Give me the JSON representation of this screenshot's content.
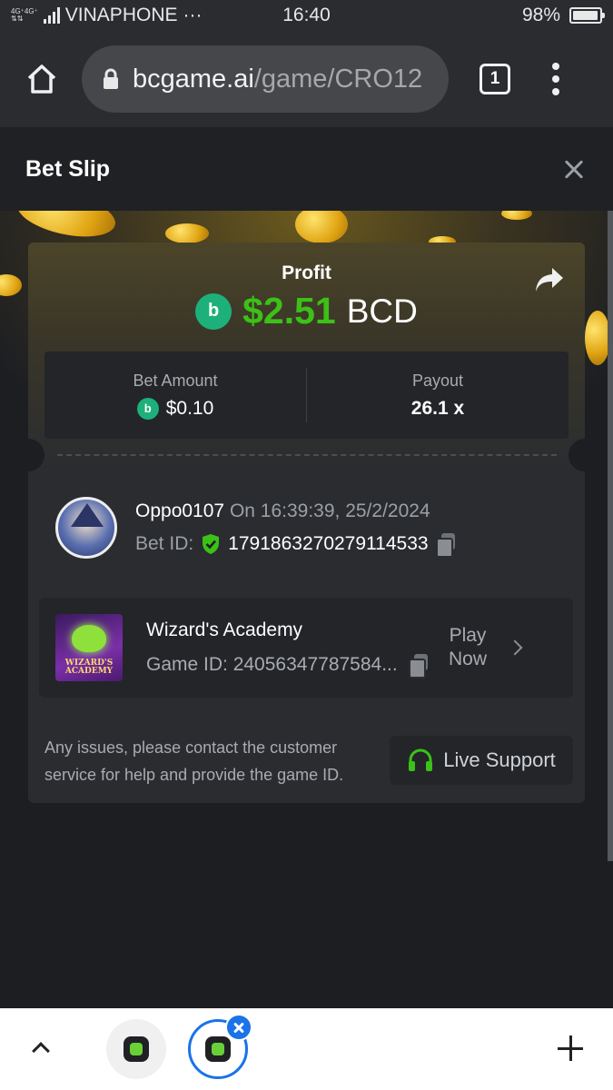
{
  "status_bar": {
    "net_top": "4G⁺4G⁺",
    "net_bottom": "⇅⇅",
    "carrier": "VINAPHONE",
    "more": "···",
    "time": "16:40",
    "battery_percent": "98%",
    "battery_level": 0.98
  },
  "browser": {
    "url_domain": "bcgame.ai",
    "url_path": "/game/CRO12",
    "tab_count": "1",
    "icons": [
      "home-icon",
      "lock-icon",
      "tabs-icon",
      "more-vert-icon"
    ]
  },
  "slip": {
    "title": "Bet Slip",
    "profit_label": "Profit",
    "profit_coin": "b",
    "profit_amount": "$2.51",
    "profit_currency": "BCD",
    "bet_amount_label": "Bet Amount",
    "bet_amount_value": "$0.10",
    "payout_label": "Payout",
    "payout_value": "26.1 x",
    "accent_green": "#3bc117",
    "coin_color": "#1db07a"
  },
  "user": {
    "name": "Oppo0107",
    "timestamp": "On 16:39:39, 25/2/2024",
    "bet_id_label": "Bet ID:",
    "bet_id": "1791863270279114533"
  },
  "game": {
    "name": "Wizard's Academy",
    "thumb_title": "WIZARD'S",
    "thumb_subtitle": "ACADEMY",
    "game_id_label": "Game ID:",
    "game_id": "24056347787584...",
    "play_now": "Play Now"
  },
  "support": {
    "help_text": "Any issues, please contact the customer service for help and provide the game ID.",
    "button_label": "Live Support"
  },
  "bottom_bar": {
    "icons": [
      "chevron-up-icon",
      "bc-app-icon",
      "plus-icon"
    ]
  }
}
